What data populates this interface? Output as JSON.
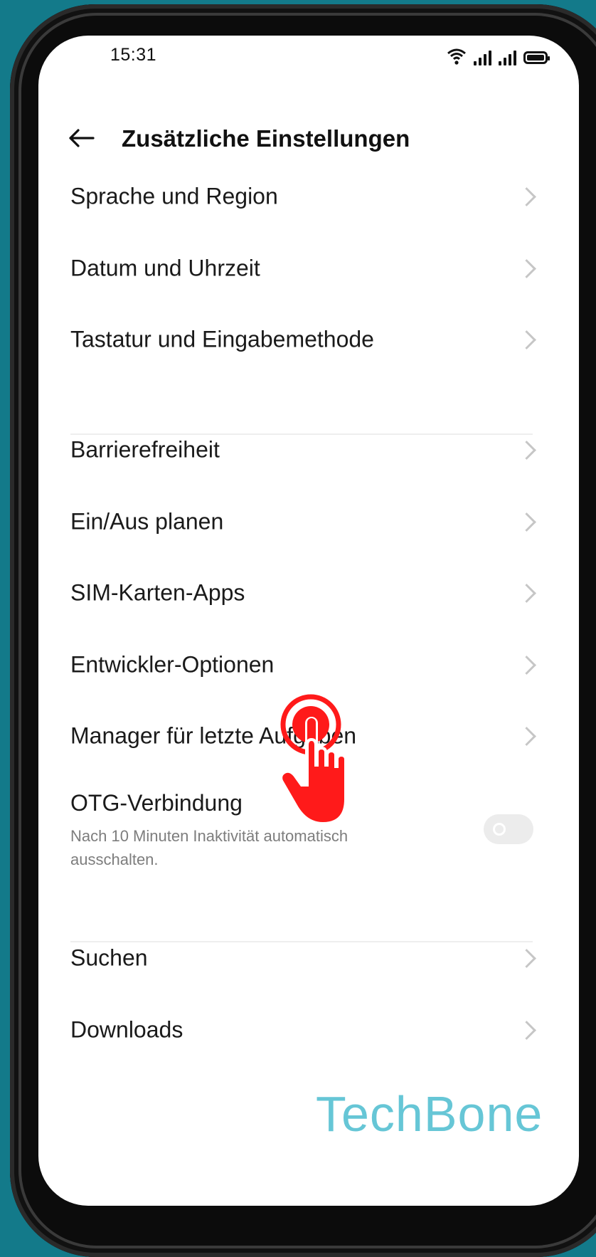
{
  "status_bar": {
    "time": "15:31"
  },
  "header": {
    "title": "Zusätzliche Einstellungen"
  },
  "group1": [
    {
      "label": "Sprache und Region"
    },
    {
      "label": "Datum und Uhrzeit"
    },
    {
      "label": "Tastatur und Eingabemethode"
    }
  ],
  "group2": [
    {
      "label": "Barrierefreiheit"
    },
    {
      "label": "Ein/Aus planen"
    },
    {
      "label": "SIM-Karten-Apps"
    },
    {
      "label": "Entwickler-Optionen"
    },
    {
      "label": "Manager für letzte Aufgaben"
    }
  ],
  "otg": {
    "title": "OTG-Verbindung",
    "subtitle": "Nach 10 Minuten Inaktivität automatisch ausschalten.",
    "enabled": false
  },
  "group3": [
    {
      "label": "Suchen"
    },
    {
      "label": "Downloads"
    }
  ],
  "watermark": "TechBone",
  "colors": {
    "background": "#137a8a",
    "touch_indicator": "#ff1a1a",
    "watermark": "#66c6d6"
  }
}
